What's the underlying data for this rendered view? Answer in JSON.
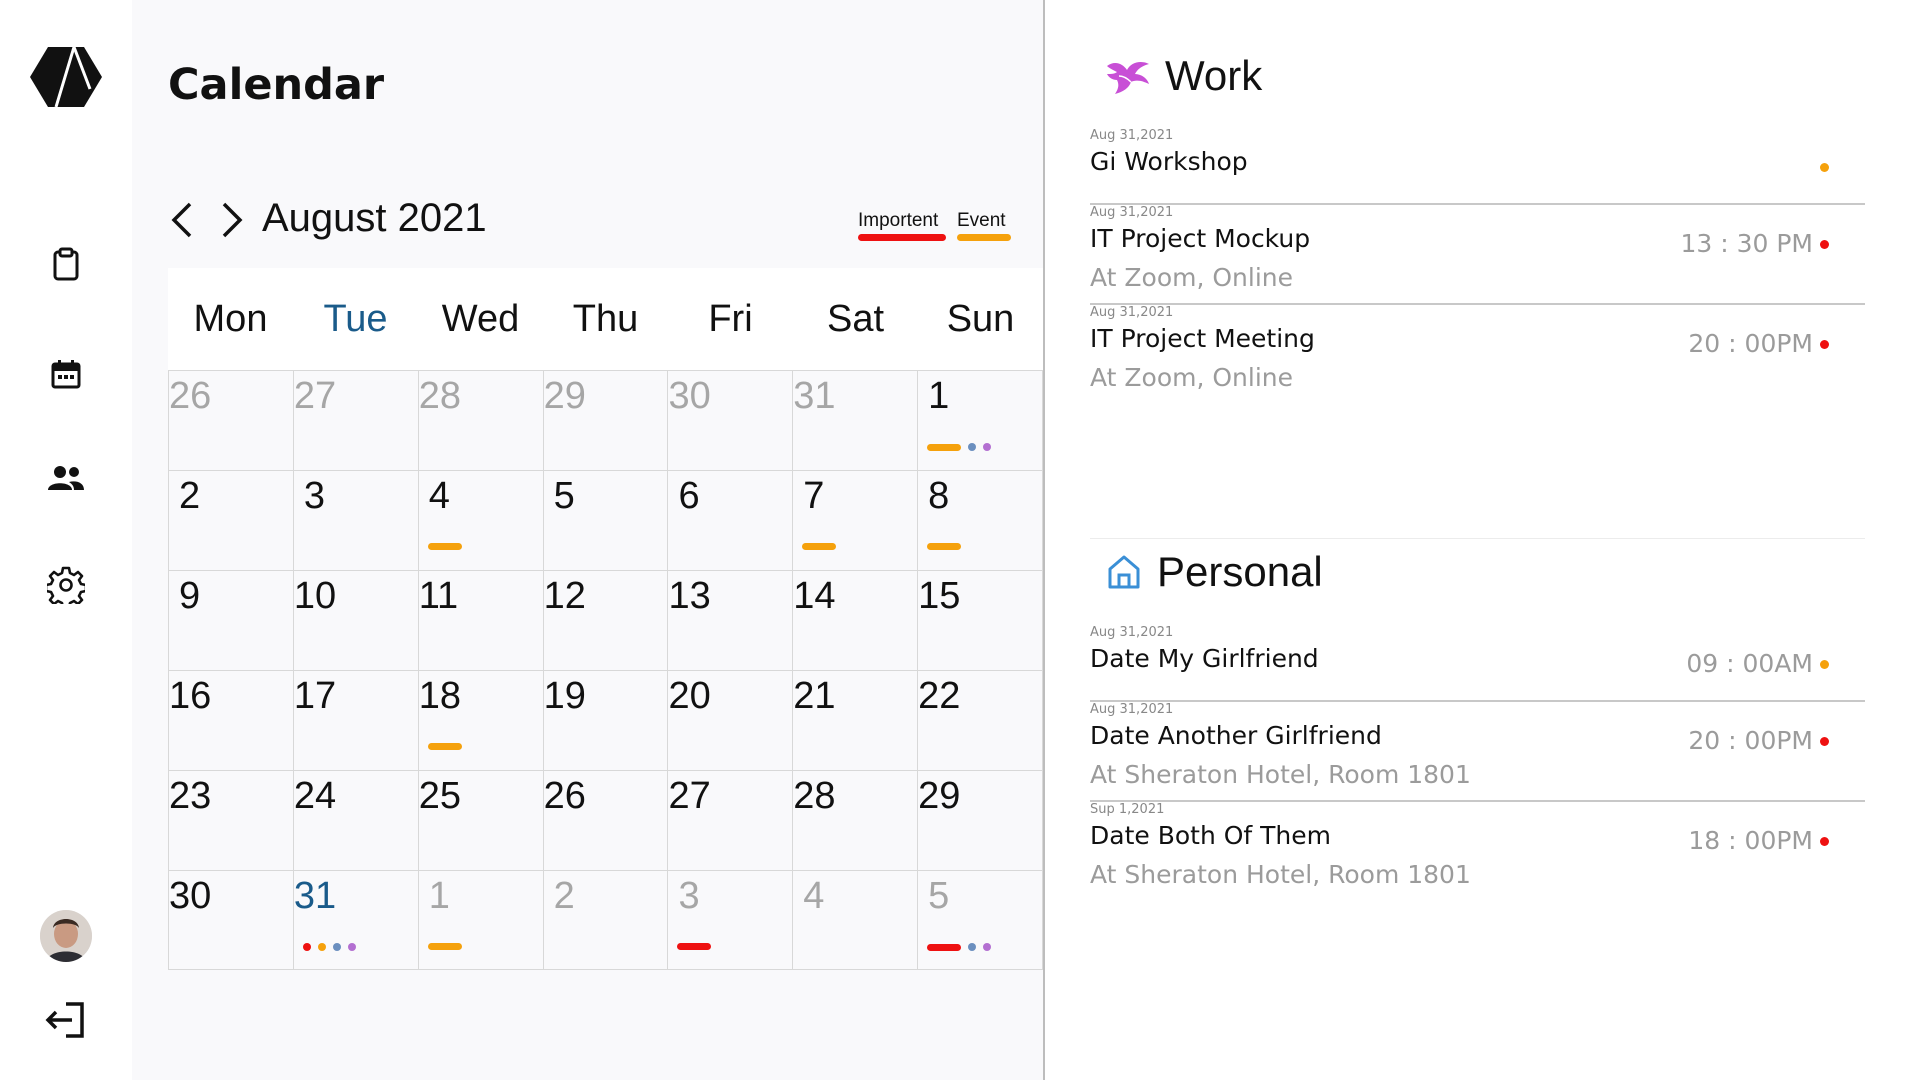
{
  "app": {
    "title": "Calendar"
  },
  "sidebar": {
    "items": [
      {
        "icon": "clipboard-icon"
      },
      {
        "icon": "calendar-icon"
      },
      {
        "icon": "people-icon"
      },
      {
        "icon": "gear-icon"
      }
    ],
    "logout_icon": "logout-icon"
  },
  "calendar": {
    "month_label": "August 2021",
    "legend": {
      "important_label": "Importent",
      "event_label": "Event"
    },
    "colors": {
      "important": "#ee1111",
      "event": "#f5a10c",
      "blue_dot": "#6b8fbf",
      "purple_dot": "#b36fd1",
      "today": "#1a5b8a"
    },
    "weekdays": [
      "Mon",
      "Tue",
      "Wed",
      "Thu",
      "Fri",
      "Sat",
      "Sun"
    ],
    "today_weekday_index": 1,
    "weeks": [
      [
        {
          "d": "26",
          "other": true
        },
        {
          "d": "27",
          "other": true
        },
        {
          "d": "28",
          "other": true
        },
        {
          "d": "29",
          "other": true
        },
        {
          "d": "30",
          "other": true
        },
        {
          "d": "31",
          "other": true
        },
        {
          "d": "1",
          "marks": [
            "event-bar",
            "blue-dot",
            "purple-dot"
          ]
        }
      ],
      [
        {
          "d": "2"
        },
        {
          "d": "3"
        },
        {
          "d": "4",
          "marks": [
            "event-bar"
          ]
        },
        {
          "d": "5"
        },
        {
          "d": "6"
        },
        {
          "d": "7",
          "marks": [
            "event-bar"
          ]
        },
        {
          "d": "8",
          "marks": [
            "event-bar"
          ]
        }
      ],
      [
        {
          "d": "9"
        },
        {
          "d": "10"
        },
        {
          "d": "11"
        },
        {
          "d": "12"
        },
        {
          "d": "13"
        },
        {
          "d": "14"
        },
        {
          "d": "15"
        }
      ],
      [
        {
          "d": "16"
        },
        {
          "d": "17"
        },
        {
          "d": "18",
          "marks": [
            "event-bar"
          ]
        },
        {
          "d": "19"
        },
        {
          "d": "20"
        },
        {
          "d": "21"
        },
        {
          "d": "22"
        }
      ],
      [
        {
          "d": "23"
        },
        {
          "d": "24"
        },
        {
          "d": "25"
        },
        {
          "d": "26"
        },
        {
          "d": "27"
        },
        {
          "d": "28"
        },
        {
          "d": "29"
        }
      ],
      [
        {
          "d": "30"
        },
        {
          "d": "31",
          "today": true,
          "marks": [
            "red-dot",
            "orange-dot",
            "blue-dot",
            "purple-dot"
          ]
        },
        {
          "d": "1",
          "other": true,
          "marks": [
            "event-bar"
          ]
        },
        {
          "d": "2",
          "other": true
        },
        {
          "d": "3",
          "other": true,
          "marks": [
            "important-bar"
          ]
        },
        {
          "d": "4",
          "other": true
        },
        {
          "d": "5",
          "other": true,
          "marks": [
            "important-bar",
            "blue-dot",
            "purple-dot"
          ]
        }
      ]
    ]
  },
  "work": {
    "title": "Work",
    "icon": "phoenix-icon",
    "events": [
      {
        "date": "Aug 31,2021",
        "title": "Gi Workshop",
        "time": "",
        "location": "",
        "dot_color": "#f5a10c"
      },
      {
        "date": "Aug 31,2021",
        "title": "IT Project Mockup",
        "time": "13 : 30 PM",
        "location": "At Zoom, Online",
        "dot_color": "#ee1111"
      },
      {
        "date": "Aug 31,2021",
        "title": "IT Project Meeting",
        "time": "20 : 00PM",
        "location": "At Zoom, Online",
        "dot_color": "#ee1111"
      }
    ]
  },
  "personal": {
    "title": "Personal",
    "icon": "home-icon",
    "events": [
      {
        "date": "Aug 31,2021",
        "title": "Date My Girlfriend",
        "time": "09 : 00AM",
        "location": "",
        "dot_color": "#f5a10c"
      },
      {
        "date": "Aug 31,2021",
        "title": "Date Another Girlfriend",
        "time": "20 : 00PM",
        "location": "At Sheraton Hotel,  Room 1801",
        "dot_color": "#ee1111"
      },
      {
        "date": "Sup 1,2021",
        "title": "Date Both Of Them",
        "time": "18 : 00PM",
        "location": "At Sheraton Hotel,  Room 1801",
        "dot_color": "#ee1111"
      }
    ]
  }
}
